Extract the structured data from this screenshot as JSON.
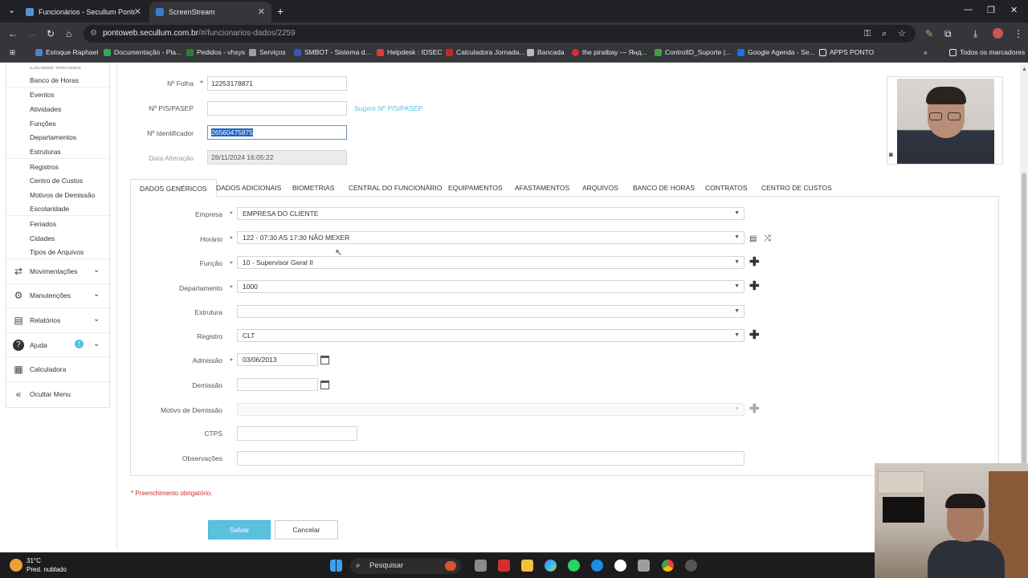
{
  "browser": {
    "tabs": [
      {
        "title": "Funcionários - Secullum Ponto W",
        "active": false
      },
      {
        "title": "ScreenStream",
        "active": true
      }
    ],
    "url_host": "pontoweb.secullum.com.br",
    "url_path": "/#/funcionarios-dados/2259",
    "bookmarks": [
      "Estoque Raphael",
      "Documentação - Pla...",
      "Pedidos - vhsys",
      "Serviços",
      "SMBOT - Sistema d...",
      "Helpdesk : IDSEC",
      "Calculadora Jornada...",
      "Bancada",
      "the piratbay — Янд...",
      "ControlID_Suporte |...",
      "Google Agenda - Se...",
      "APPS PONTO"
    ],
    "all_bookmarks": "Todos os marcadores"
  },
  "sidebar": {
    "partial_top": "Escalas Mensais",
    "items": [
      "Banco de Horas",
      "Eventos",
      "Atividades",
      "Funções",
      "Departamentos",
      "Estruturas",
      "Registros",
      "Centro de Custos",
      "Motivos de Demissão",
      "Escolaridade",
      "Feriados",
      "Cidades",
      "Tipos de Arquivos"
    ],
    "menus": [
      {
        "label": "Movimentações",
        "icon": "swap-icon"
      },
      {
        "label": "Manutenções",
        "icon": "gear-icon"
      },
      {
        "label": "Relatórios",
        "icon": "report-icon"
      },
      {
        "label": "Ajuda",
        "icon": "help-icon",
        "badge": "!"
      },
      {
        "label": "Calculadora",
        "icon": "calculator-icon"
      },
      {
        "label": "Ocultar Menu",
        "icon": "double-chevron-left-icon"
      }
    ]
  },
  "form": {
    "folha_label": "Nº Folha",
    "folha_value": "12253178871",
    "pis_label": "Nº PIS/PASEP",
    "pis_value": "",
    "pis_suggest": "Sugerir Nº PIS/PASEP",
    "ident_label": "Nº Identificador",
    "ident_value": "26560475875",
    "data_alt_label": "Data Alteração",
    "data_alt_value": "28/11/2024 16:05:22"
  },
  "tabs": [
    "DADOS GENÉRICOS",
    "DADOS ADICIONAIS",
    "BIOMETRIAS",
    "CENTRAL DO FUNCIONÁRIO",
    "EQUIPAMENTOS",
    "AFASTAMENTOS",
    "ARQUIVOS",
    "BANCO DE HORAS",
    "CONTRATOS",
    "CENTRO DE CUSTOS"
  ],
  "generic": {
    "empresa_label": "Empresa",
    "empresa_value": "EMPRESA DO CLIENTE",
    "horario_label": "Horário",
    "horario_value": "122 - 07:30 AS 17:30 NÃO MEXER",
    "funcao_label": "Função",
    "funcao_value": "10 - Supervisor Geral II",
    "departamento_label": "Departamento",
    "departamento_value": "1000",
    "estrutura_label": "Estrutura",
    "estrutura_value": "",
    "registro_label": "Registro",
    "registro_value": "CLT",
    "admissao_label": "Admissão",
    "admissao_value": "03/06/2013",
    "demissao_label": "Demissão",
    "demissao_value": "",
    "motivo_label": "Motivo de Demissão",
    "motivo_value": "",
    "ctps_label": "CTPS",
    "ctps_value": "",
    "obs_label": "Observações",
    "obs_value": ""
  },
  "footer": {
    "required_note": "* Preenchimento obrigatório.",
    "save": "Salvar",
    "cancel": "Cancelar"
  },
  "taskbar": {
    "temp": "31°C",
    "weather": "Pred. nublado",
    "search": "Pesquisar"
  }
}
